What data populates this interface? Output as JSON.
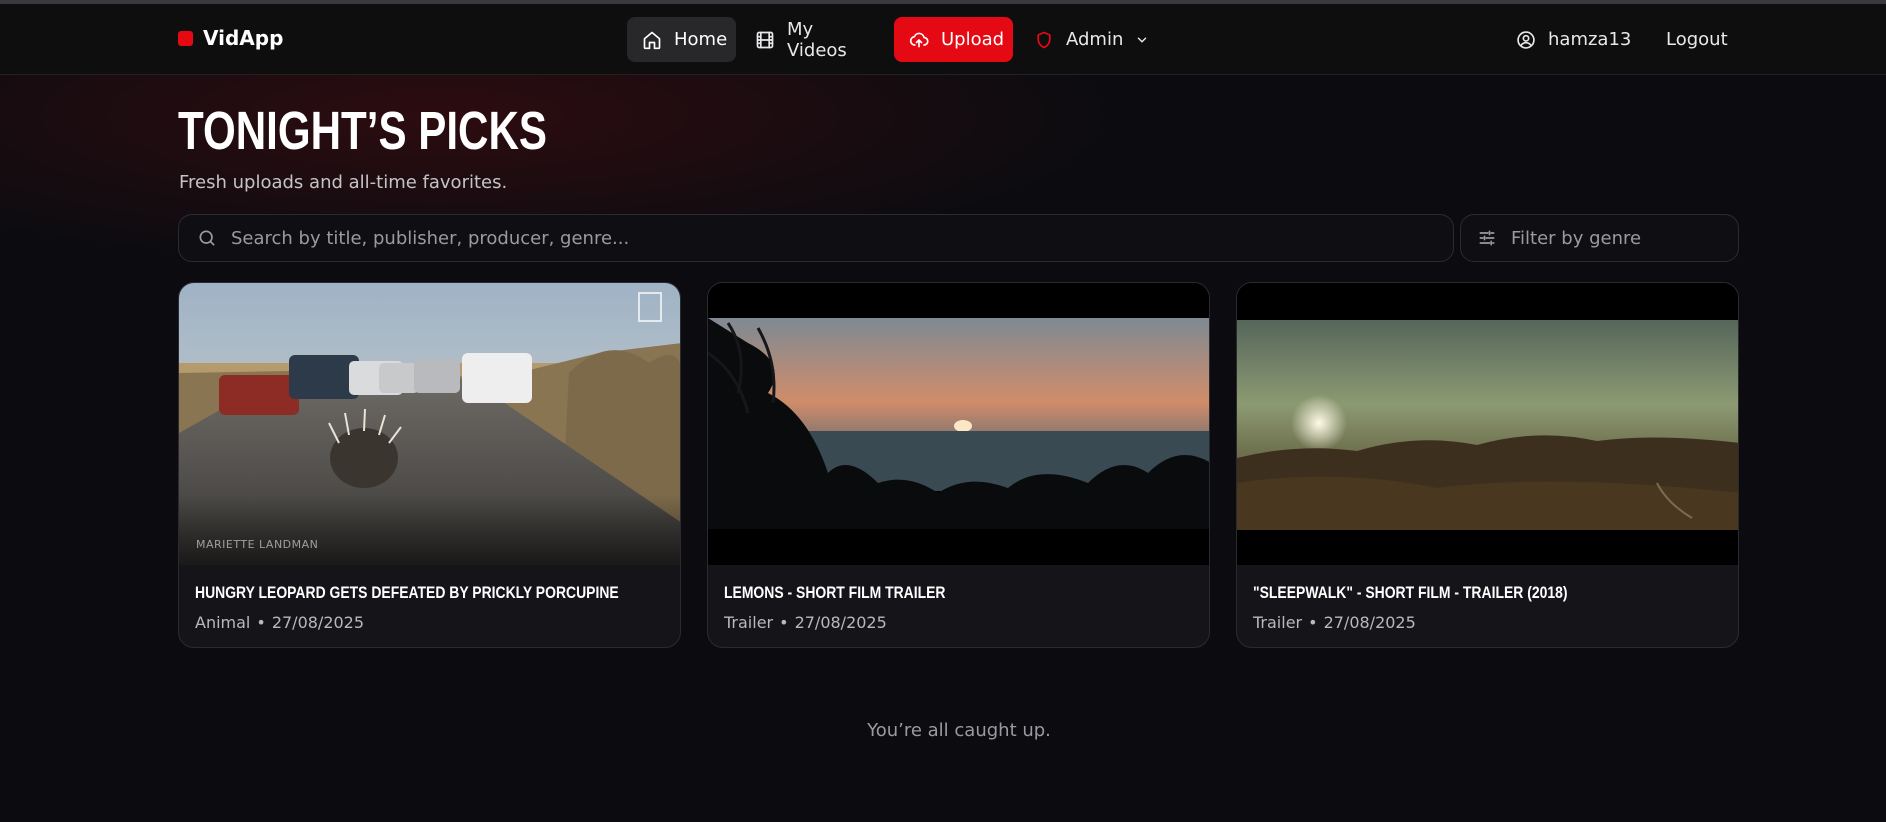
{
  "app": {
    "name": "VidApp",
    "brand_color": "#e50914"
  },
  "nav": {
    "home": "Home",
    "my_videos": "My Videos",
    "upload": "Upload",
    "admin": "Admin"
  },
  "user": {
    "name": "hamza13",
    "logout": "Logout"
  },
  "page": {
    "title": "Tonight’s Picks",
    "subtitle": "Fresh uploads and all-time favorites."
  },
  "search": {
    "placeholder": "Search by title, publisher, producer, genre..."
  },
  "filter": {
    "placeholder": "Filter by genre"
  },
  "videos": [
    {
      "title": "Hungry Leopard Gets Defeated By Prickly Porcupine",
      "genre": "Animal",
      "date": "27/08/2025",
      "watermark": "MARIETTE LANDMAN"
    },
    {
      "title": "Lemons - Short Film Trailer",
      "genre": "Trailer",
      "date": "27/08/2025"
    },
    {
      "title": "\"SLEEPWALK\" - Short Film - Trailer (2018)",
      "genre": "Trailer",
      "date": "27/08/2025"
    }
  ],
  "footer": {
    "message": "You’re all caught up."
  },
  "icons": {
    "home": "home-icon",
    "videos": "film-icon",
    "upload": "cloud-upload-icon",
    "admin": "shield-icon",
    "user": "user-circle-icon",
    "search": "search-icon",
    "filter": "sliders-icon"
  }
}
